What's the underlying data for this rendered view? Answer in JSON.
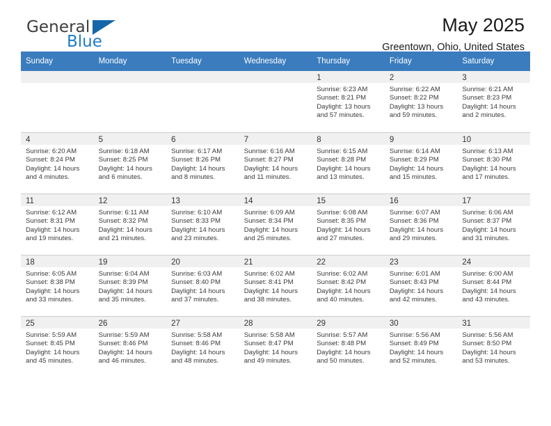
{
  "brand": {
    "name_part1": "General",
    "name_part2": "Blue"
  },
  "header": {
    "title": "May 2025",
    "subtitle": "Greentown, Ohio, United States"
  },
  "colors": {
    "header_blue": "#3a7cbe",
    "brand_blue": "#1f7cc4",
    "daynum_band": "#f0f0f0",
    "grid_line": "#cdcdcd"
  },
  "weekday_headers": [
    "Sunday",
    "Monday",
    "Tuesday",
    "Wednesday",
    "Thursday",
    "Friday",
    "Saturday"
  ],
  "weeks": [
    [
      {
        "day": "",
        "sunrise": "",
        "sunset": "",
        "daylight_line1": "",
        "daylight_line2": ""
      },
      {
        "day": "",
        "sunrise": "",
        "sunset": "",
        "daylight_line1": "",
        "daylight_line2": ""
      },
      {
        "day": "",
        "sunrise": "",
        "sunset": "",
        "daylight_line1": "",
        "daylight_line2": ""
      },
      {
        "day": "",
        "sunrise": "",
        "sunset": "",
        "daylight_line1": "",
        "daylight_line2": ""
      },
      {
        "day": "1",
        "sunrise": "Sunrise: 6:23 AM",
        "sunset": "Sunset: 8:21 PM",
        "daylight_line1": "Daylight: 13 hours",
        "daylight_line2": "and 57 minutes."
      },
      {
        "day": "2",
        "sunrise": "Sunrise: 6:22 AM",
        "sunset": "Sunset: 8:22 PM",
        "daylight_line1": "Daylight: 13 hours",
        "daylight_line2": "and 59 minutes."
      },
      {
        "day": "3",
        "sunrise": "Sunrise: 6:21 AM",
        "sunset": "Sunset: 8:23 PM",
        "daylight_line1": "Daylight: 14 hours",
        "daylight_line2": "and 2 minutes."
      }
    ],
    [
      {
        "day": "4",
        "sunrise": "Sunrise: 6:20 AM",
        "sunset": "Sunset: 8:24 PM",
        "daylight_line1": "Daylight: 14 hours",
        "daylight_line2": "and 4 minutes."
      },
      {
        "day": "5",
        "sunrise": "Sunrise: 6:18 AM",
        "sunset": "Sunset: 8:25 PM",
        "daylight_line1": "Daylight: 14 hours",
        "daylight_line2": "and 6 minutes."
      },
      {
        "day": "6",
        "sunrise": "Sunrise: 6:17 AM",
        "sunset": "Sunset: 8:26 PM",
        "daylight_line1": "Daylight: 14 hours",
        "daylight_line2": "and 8 minutes."
      },
      {
        "day": "7",
        "sunrise": "Sunrise: 6:16 AM",
        "sunset": "Sunset: 8:27 PM",
        "daylight_line1": "Daylight: 14 hours",
        "daylight_line2": "and 11 minutes."
      },
      {
        "day": "8",
        "sunrise": "Sunrise: 6:15 AM",
        "sunset": "Sunset: 8:28 PM",
        "daylight_line1": "Daylight: 14 hours",
        "daylight_line2": "and 13 minutes."
      },
      {
        "day": "9",
        "sunrise": "Sunrise: 6:14 AM",
        "sunset": "Sunset: 8:29 PM",
        "daylight_line1": "Daylight: 14 hours",
        "daylight_line2": "and 15 minutes."
      },
      {
        "day": "10",
        "sunrise": "Sunrise: 6:13 AM",
        "sunset": "Sunset: 8:30 PM",
        "daylight_line1": "Daylight: 14 hours",
        "daylight_line2": "and 17 minutes."
      }
    ],
    [
      {
        "day": "11",
        "sunrise": "Sunrise: 6:12 AM",
        "sunset": "Sunset: 8:31 PM",
        "daylight_line1": "Daylight: 14 hours",
        "daylight_line2": "and 19 minutes."
      },
      {
        "day": "12",
        "sunrise": "Sunrise: 6:11 AM",
        "sunset": "Sunset: 8:32 PM",
        "daylight_line1": "Daylight: 14 hours",
        "daylight_line2": "and 21 minutes."
      },
      {
        "day": "13",
        "sunrise": "Sunrise: 6:10 AM",
        "sunset": "Sunset: 8:33 PM",
        "daylight_line1": "Daylight: 14 hours",
        "daylight_line2": "and 23 minutes."
      },
      {
        "day": "14",
        "sunrise": "Sunrise: 6:09 AM",
        "sunset": "Sunset: 8:34 PM",
        "daylight_line1": "Daylight: 14 hours",
        "daylight_line2": "and 25 minutes."
      },
      {
        "day": "15",
        "sunrise": "Sunrise: 6:08 AM",
        "sunset": "Sunset: 8:35 PM",
        "daylight_line1": "Daylight: 14 hours",
        "daylight_line2": "and 27 minutes."
      },
      {
        "day": "16",
        "sunrise": "Sunrise: 6:07 AM",
        "sunset": "Sunset: 8:36 PM",
        "daylight_line1": "Daylight: 14 hours",
        "daylight_line2": "and 29 minutes."
      },
      {
        "day": "17",
        "sunrise": "Sunrise: 6:06 AM",
        "sunset": "Sunset: 8:37 PM",
        "daylight_line1": "Daylight: 14 hours",
        "daylight_line2": "and 31 minutes."
      }
    ],
    [
      {
        "day": "18",
        "sunrise": "Sunrise: 6:05 AM",
        "sunset": "Sunset: 8:38 PM",
        "daylight_line1": "Daylight: 14 hours",
        "daylight_line2": "and 33 minutes."
      },
      {
        "day": "19",
        "sunrise": "Sunrise: 6:04 AM",
        "sunset": "Sunset: 8:39 PM",
        "daylight_line1": "Daylight: 14 hours",
        "daylight_line2": "and 35 minutes."
      },
      {
        "day": "20",
        "sunrise": "Sunrise: 6:03 AM",
        "sunset": "Sunset: 8:40 PM",
        "daylight_line1": "Daylight: 14 hours",
        "daylight_line2": "and 37 minutes."
      },
      {
        "day": "21",
        "sunrise": "Sunrise: 6:02 AM",
        "sunset": "Sunset: 8:41 PM",
        "daylight_line1": "Daylight: 14 hours",
        "daylight_line2": "and 38 minutes."
      },
      {
        "day": "22",
        "sunrise": "Sunrise: 6:02 AM",
        "sunset": "Sunset: 8:42 PM",
        "daylight_line1": "Daylight: 14 hours",
        "daylight_line2": "and 40 minutes."
      },
      {
        "day": "23",
        "sunrise": "Sunrise: 6:01 AM",
        "sunset": "Sunset: 8:43 PM",
        "daylight_line1": "Daylight: 14 hours",
        "daylight_line2": "and 42 minutes."
      },
      {
        "day": "24",
        "sunrise": "Sunrise: 6:00 AM",
        "sunset": "Sunset: 8:44 PM",
        "daylight_line1": "Daylight: 14 hours",
        "daylight_line2": "and 43 minutes."
      }
    ],
    [
      {
        "day": "25",
        "sunrise": "Sunrise: 5:59 AM",
        "sunset": "Sunset: 8:45 PM",
        "daylight_line1": "Daylight: 14 hours",
        "daylight_line2": "and 45 minutes."
      },
      {
        "day": "26",
        "sunrise": "Sunrise: 5:59 AM",
        "sunset": "Sunset: 8:46 PM",
        "daylight_line1": "Daylight: 14 hours",
        "daylight_line2": "and 46 minutes."
      },
      {
        "day": "27",
        "sunrise": "Sunrise: 5:58 AM",
        "sunset": "Sunset: 8:46 PM",
        "daylight_line1": "Daylight: 14 hours",
        "daylight_line2": "and 48 minutes."
      },
      {
        "day": "28",
        "sunrise": "Sunrise: 5:58 AM",
        "sunset": "Sunset: 8:47 PM",
        "daylight_line1": "Daylight: 14 hours",
        "daylight_line2": "and 49 minutes."
      },
      {
        "day": "29",
        "sunrise": "Sunrise: 5:57 AM",
        "sunset": "Sunset: 8:48 PM",
        "daylight_line1": "Daylight: 14 hours",
        "daylight_line2": "and 50 minutes."
      },
      {
        "day": "30",
        "sunrise": "Sunrise: 5:56 AM",
        "sunset": "Sunset: 8:49 PM",
        "daylight_line1": "Daylight: 14 hours",
        "daylight_line2": "and 52 minutes."
      },
      {
        "day": "31",
        "sunrise": "Sunrise: 5:56 AM",
        "sunset": "Sunset: 8:50 PM",
        "daylight_line1": "Daylight: 14 hours",
        "daylight_line2": "and 53 minutes."
      }
    ]
  ]
}
